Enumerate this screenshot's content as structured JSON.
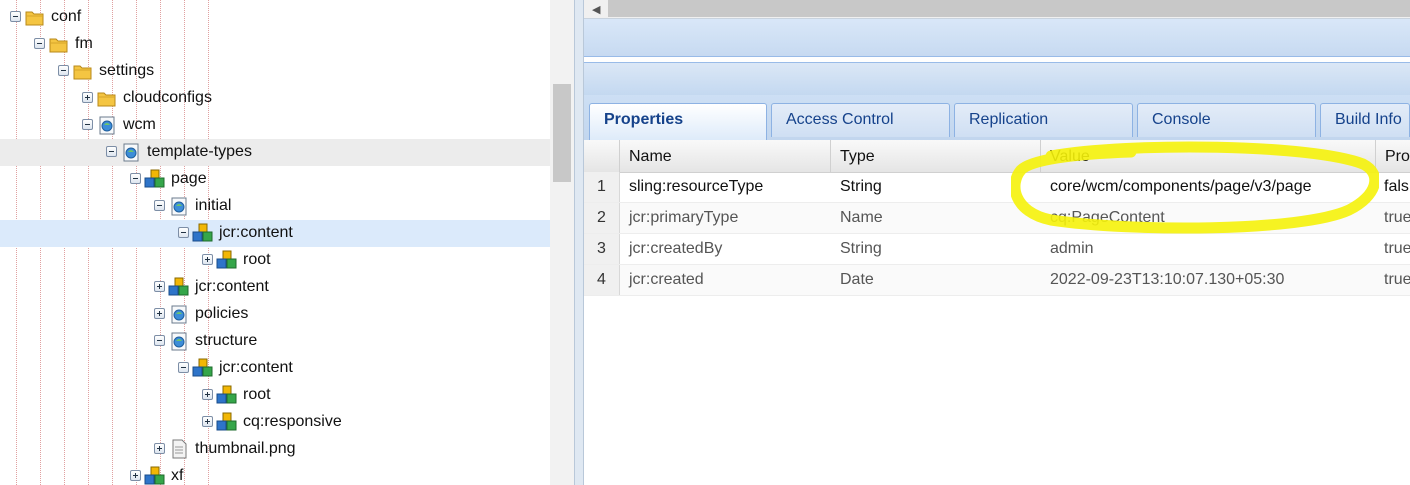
{
  "tree": {
    "nodes": [
      {
        "label": "conf",
        "icon": "folder-icon",
        "toggle": "minus"
      },
      {
        "label": "fm",
        "icon": "folder-icon",
        "toggle": "minus"
      },
      {
        "label": "settings",
        "icon": "folder-icon",
        "toggle": "minus"
      },
      {
        "label": "cloudconfigs",
        "icon": "folder-icon",
        "toggle": "plus"
      },
      {
        "label": "wcm",
        "icon": "page-node-icon",
        "toggle": "minus"
      },
      {
        "label": "template-types",
        "icon": "page-node-icon",
        "toggle": "minus"
      },
      {
        "label": "page",
        "icon": "component-node-icon",
        "toggle": "minus"
      },
      {
        "label": "initial",
        "icon": "page-node-icon",
        "toggle": "minus"
      },
      {
        "label": "jcr:content",
        "icon": "component-node-icon",
        "toggle": "minus"
      },
      {
        "label": "root",
        "icon": "component-node-icon",
        "toggle": "plus"
      },
      {
        "label": "jcr:content",
        "icon": "component-node-icon",
        "toggle": "plus"
      },
      {
        "label": "policies",
        "icon": "page-node-icon",
        "toggle": "plus"
      },
      {
        "label": "structure",
        "icon": "page-node-icon",
        "toggle": "minus"
      },
      {
        "label": "jcr:content",
        "icon": "component-node-icon",
        "toggle": "minus"
      },
      {
        "label": "root",
        "icon": "component-node-icon",
        "toggle": "plus"
      },
      {
        "label": "cq:responsive",
        "icon": "component-node-icon",
        "toggle": "plus"
      },
      {
        "label": "thumbnail.png",
        "icon": "file-icon",
        "toggle": "plus"
      },
      {
        "label": "xf",
        "icon": "component-node-icon",
        "toggle": "plus"
      }
    ]
  },
  "tabs": [
    {
      "label": "Properties",
      "active": true
    },
    {
      "label": "Access Control",
      "active": false
    },
    {
      "label": "Replication",
      "active": false
    },
    {
      "label": "Console",
      "active": false
    },
    {
      "label": "Build Info",
      "active": false
    }
  ],
  "grid": {
    "columns": [
      "Name",
      "Type",
      "Value",
      "Pro"
    ],
    "rows": [
      {
        "num": "1",
        "name": "sling:resourceType",
        "type": "String",
        "value": "core/wcm/components/page/v3/page",
        "protected": "fals"
      },
      {
        "num": "2",
        "name": "jcr:primaryType",
        "type": "Name",
        "value": "cq:PageContent",
        "protected": "true"
      },
      {
        "num": "3",
        "name": "jcr:createdBy",
        "type": "String",
        "value": "admin",
        "protected": "true"
      },
      {
        "num": "4",
        "name": "jcr:created",
        "type": "Date",
        "value": "2022-09-23T13:10:07.130+05:30",
        "protected": "true"
      }
    ]
  },
  "colors": {
    "annotation": "#f5f20a",
    "tab_text": "#15428b"
  }
}
